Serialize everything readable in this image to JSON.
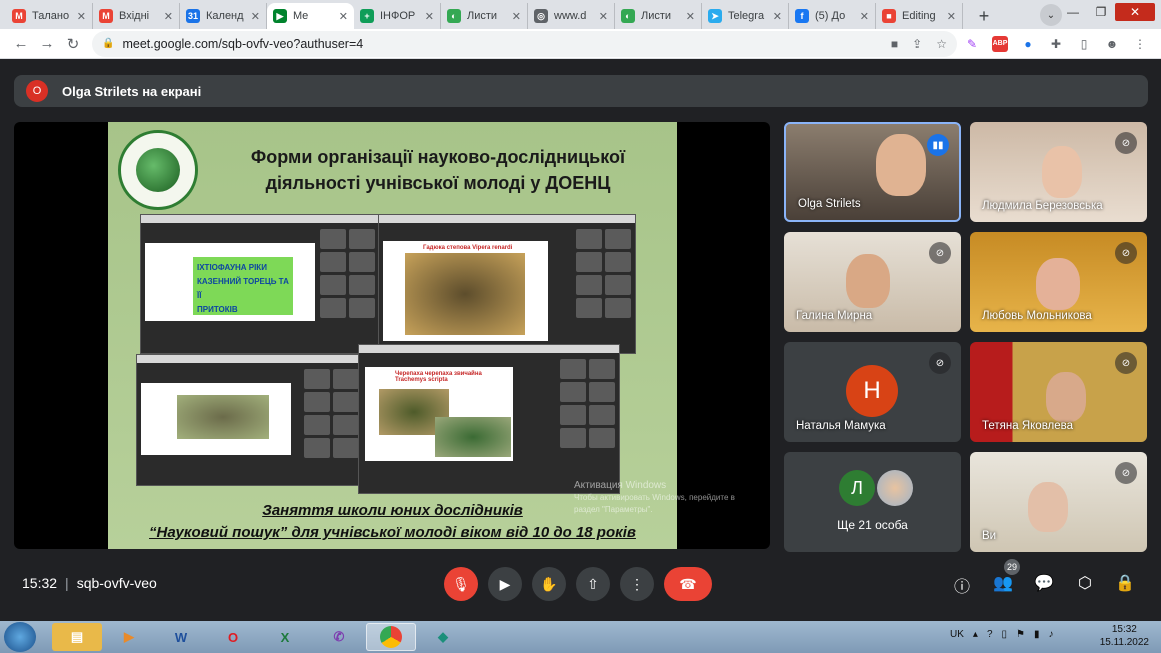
{
  "browser": {
    "tabs": [
      {
        "title": "Талано",
        "color": "#ea4335",
        "glyph": "M"
      },
      {
        "title": "Вхідні",
        "color": "#ea4335",
        "glyph": "M"
      },
      {
        "title": "Календ",
        "color": "#1a73e8",
        "glyph": "31"
      },
      {
        "title": "Me",
        "color": "#00832d",
        "glyph": "▶",
        "active": true
      },
      {
        "title": "ІНФОР",
        "color": "#0f9d58",
        "glyph": "+"
      },
      {
        "title": "Листи",
        "color": "#34a853",
        "glyph": "◐"
      },
      {
        "title": "www.d",
        "color": "#5f6368",
        "glyph": "◎"
      },
      {
        "title": "Листи",
        "color": "#34a853",
        "glyph": "◐"
      },
      {
        "title": "Telegra",
        "color": "#2aabee",
        "glyph": "➤"
      },
      {
        "title": "(5) До",
        "color": "#1877f2",
        "glyph": "f"
      },
      {
        "title": "Editing",
        "color": "#ea4335",
        "glyph": "■"
      }
    ],
    "url": "meet.google.com/sqb-ovfv-veo?authuser=4"
  },
  "meet": {
    "presenter_initial": "O",
    "presenting_text": "Olga Strilets на екрані",
    "slide": {
      "title_line1": "Форми організації науково-дослідницької",
      "title_line2": "діяльності учнівської молоді у ДОЕНЦ",
      "box1_line1": "ІХТІОФАУНА РІКИ",
      "box1_line2": "КАЗЕННИЙ ТОРЕЦЬ ТА ЇЇ",
      "box1_line3": "ПРИТОКІВ",
      "box2_title": "Гадюка степова Vipera renardi",
      "box3_title_line1": "Черепаха черепаха звичайна",
      "box3_title_line2": "Trachemys scripta",
      "bottom_line1": "Заняття школи юних дослідників",
      "bottom_line2": "“Науковий пошук”  для учнівської молоді віком від 10 до 18 років",
      "watermark_line1": "Активация Windows",
      "watermark_line2": "Чтобы активировать Windows, перейдите в",
      "watermark_line3": "раздел \"Параметры\"."
    },
    "participants": [
      {
        "name": "Olga Strilets",
        "speaking": true
      },
      {
        "name": "Людмила Березовська"
      },
      {
        "name": "Галина Мирна"
      },
      {
        "name": "Любовь Мольникова"
      },
      {
        "name": "Наталья Мамука",
        "initial": "Н"
      },
      {
        "name": "Тетяна Яковлева"
      },
      {
        "name": "Ще 21 особа",
        "initial": "Л"
      },
      {
        "name": "Ви"
      }
    ],
    "time": "15:32",
    "meeting_code": "sqb-ovfv-veo",
    "participant_count": "29"
  },
  "taskbar": {
    "lang": "UK",
    "time": "15:32",
    "date": "15.11.2022"
  }
}
